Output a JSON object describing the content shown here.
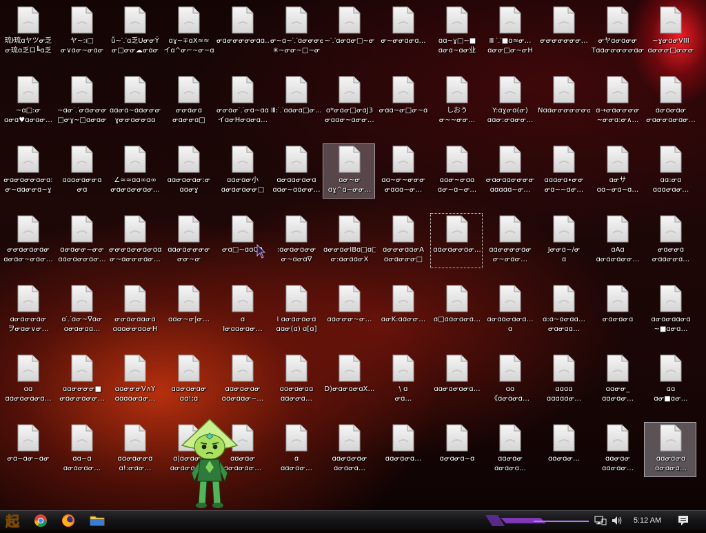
{
  "desktop": {
    "selected_icon_index": 90,
    "hover_icon_index": 32,
    "focused_icon_index": 47,
    "icons": [
      {
        "line1": "琉ŀ琉ɑヤツᓂ乏",
        "line2": "ᓂ琉ɑ乏ロ╚ɑ乏"
      },
      {
        "line1": "ヤ~:ı□",
        "line2": "ᓂ∨ɑᓂ~ᓂɑᓂ"
      },
      {
        "line1": "ǚ~⸪ɑ乏UᓂᓂŸ",
        "line2": "ᓂ□ᓂᓂ☁ᓂɑᓂ"
      },
      {
        "line1": "ɑɣ~∓ɑX≈≈",
        "line2": "イɑ^ᓂ⌐~ᓂ~ɑ"
      },
      {
        "line1": "ᓂɑᓂᓂᓂᓂᓂɑɑ…",
        "line2": ""
      },
      {
        "line1": "ᓂ~ɑ~⸪ɑᓂᓂᓂᓂ",
        "line2": "✳~ᓂᓂ~□~ᓂ"
      },
      {
        "line1": "~⸪ɑᓂɑᓂ□~ᓂ",
        "line2": ""
      },
      {
        "line1": "ᓂ~ᓂᓂɑᓂɑ…",
        "line2": ""
      },
      {
        "line1": "ɑɑ~ɣ□~■",
        "line2": "ɑᓂɑ~ɑᓂ业"
      },
      {
        "line1": "Ⅲ ⸪■ɑ≈ᓂ…",
        "line2": "ɑᓂᓂ□ᓂ~ᓂH"
      },
      {
        "line1": "ᓂᓂᓂᓂᓂᓂᓂ…",
        "line2": ""
      },
      {
        "line1": "ᓂヤɑᓂɑᓂᓂ",
        "line2": "TɑɑᓂᓂᓂᓂᓂɑᓂᓂI"
      },
      {
        "line1": "~ɣᓂɑᓂVIII",
        "line2": "ɑᓂᓂᓂ□ᓂᓂᓂ"
      },
      {
        "line1": "~ɑ□:ᓂ",
        "line2": "ɑᓂɑ♥ɑᓂɑᓂ…"
      },
      {
        "line1": "~ɑᓂ⸪ᓂɑᓂᓂᓂ",
        "line2": "□ᓂɣ~□ɑᓂɑᓂ"
      },
      {
        "line1": "ɑɑᓂɑ~ɑɑᓂᓂᓂ",
        "line2": "ɣᓂᓂɑᓂᓂɑɑ"
      },
      {
        "line1": "ᓂᓂɑᓂɑ",
        "line2": "ᓂɑᓂᓂɑ□"
      },
      {
        "line1": "ᓂᓂɑᓂ⸪ᓂɑ~ɑɑ",
        "line2": "イɑᓂHᓂɑᓂɑ…"
      },
      {
        "line1": "Ⅲ:⸪ɑɑᓂɑ□ᓂ…",
        "line2": ""
      },
      {
        "line1": "ɑ*ᓂɑᓂ□ᓂɑJ3",
        "line2": "ᓂɑɑᓂ~ɑᓂᓂ…"
      },
      {
        "line1": "ᓂɑɑ~ᓂ□ᓂ~ɑ",
        "line2": ""
      },
      {
        "line1": "しおう",
        "line2": "ᓂ~~ᓂᓂ…"
      },
      {
        "line1": "Y:ɑɣᓂɑ(ᓂ)",
        "line2": "ɑɑᓂ:ᓂɑᓂᓂ…"
      },
      {
        "line1": "NɑɑᓂᓂᓂᓂᓂᓂᓂᓂᓂŦ",
        "line2": ""
      },
      {
        "line1": "ɑ→ᓂɑᓂᓂᓂᓂ",
        "line2": "~ᓂᓂɑ:ᓂ∧…"
      },
      {
        "line1": "ɑᓂɑᓂɑᓂ",
        "line2": "ᓂɑᓂᓂɑᓂɑᓂ…"
      },
      {
        "line1": "ᓂɑᓂɑᓂᓂɑᓂɑ:",
        "line2": "ᓂ~ɑɑᓂᓂɑ~ɣ"
      },
      {
        "line1": "ɑɑɑᓂɑᓂᓂɑ",
        "line2": "ᓂɑ"
      },
      {
        "line1": "∠≈≈ɑɑ∞ɑ∞",
        "line2": "ᓂɑᓂɑᓂᓂɑᓂ…"
      },
      {
        "line1": "ɑɑᓂɑᓂɑᓂ:ᓂ",
        "line2": "ɑɑᓂɣ"
      },
      {
        "line1": "ɑɑᓂɑᓂ小",
        "line2": "ɑᓂɑᓂɑᓂᓂ□"
      },
      {
        "line1": "ɑᓂɑɑᓂɑᓂɑ",
        "line2": "ɑɑᓂ~ɑɑᓂᓂ…"
      },
      {
        "line1": "ɑᓂ~ᓂ",
        "line2": "ɑɣ^ɑ~ᓂᓂ…"
      },
      {
        "line1": "ɑɑ~ᓂ~ᓂᓂᓂ",
        "line2": "ᓂɑɑɑ~ᓂ…"
      },
      {
        "line1": "ɑɑᓂ~ᓂɑɑ",
        "line2": "ɑᓂ~ɑ~ᓂ…"
      },
      {
        "line1": "ᓂɑᓂɑɑᓂᓂᓂᓂ",
        "line2": "ɑɑɑɑɑ~ᓂ…"
      },
      {
        "line1": "ɑɑɑᓂɑ∙ᓂᓂ",
        "line2": "ᓂɑ~~ɑᓂ…"
      },
      {
        "line1": "ɑᓂサ",
        "line2": "ɑɑ~ᓂɑ~ɑ…"
      },
      {
        "line1": "ɑɑ:ᓂɑ",
        "line2": "ɑɑɑᓂɑᓂ…"
      },
      {
        "line1": "ᓂᓂɑᓂɑᓂɑᓂ",
        "line2": "ɑᓂɑᓂ~ᓂɑᓂ…"
      },
      {
        "line1": "ɑᓂɑᓂᓂ~ᓂᓂ",
        "line2": "ɑɑᓂɑᓂᓂɑᓂ…"
      },
      {
        "line1": "ᓂᓂᓂɑᓂᓂɑᓂɑɑ",
        "line2": "ᓂ~ɑᓂᓂᓂɑᓂ…"
      },
      {
        "line1": "ɑɑᓂɑᓂᓂᓂᓂ",
        "line2": "ᓂᓂ~ᓂ"
      },
      {
        "line1": "ᓂɑ□~ɑɑOA",
        "line2": ""
      },
      {
        "line1": ":ɑᓂɑᓂɑᓂᓂ",
        "line2": "ᓂ~ɑᓂɑ∇"
      },
      {
        "line1": "ɑᓂᓂɑᓂIBɑ□ɑ□",
        "line2": "ᓂ:ɑᓂɑɑᓂX"
      },
      {
        "line1": "ɑᓂᓂᓂɑɑᓂA",
        "line2": "ɑᓂɑᓂᓂᓂ□"
      },
      {
        "line1": "ɑɑᓂɑᓂᓂɑᓂ…",
        "line2": ""
      },
      {
        "line1": "ɑɑᓂᓂᓂᓂɑᓂ",
        "line2": "ᓂ~ᓂɑᓂ…"
      },
      {
        "line1": "Jᓂᓂɑ~∕ᓂ",
        "line2": "ɑ"
      },
      {
        "line1": "ɑAɑ",
        "line2": "ɑᓂɑᓂɑᓂᓂ…"
      },
      {
        "line1": "ᓂɑᓂᓂɑ",
        "line2": "ᓂɑɑᓂᓂɑ…"
      },
      {
        "line1": "ɑᓂɑᓂᓂɑᓂ",
        "line2": "ヲᓂɑᓂ∨ᓂ…"
      },
      {
        "line1": "ɑ⸪ɑᓂ~∇ɑᓂ",
        "line2": "ɑᓂɑᓂɑɑ…"
      },
      {
        "line1": "ᓂᓂɑᓂɑɑᓂɑ",
        "line2": "ɑɑɑᓂᓂɑɑᓂH"
      },
      {
        "line1": "ɑɑᓂ~ᓂ|ᓂ…",
        "line2": ""
      },
      {
        "line1": "ɑ",
        "line2": "Iᓂɑɑᓂɑᓂ…"
      },
      {
        "line1": "Ⅰ ɑᓂɑᓂɑᓂɑ",
        "line2": "ɑɑᓂ(ɑ) ɑ[ɑ]"
      },
      {
        "line1": "ɑɑᓂᓂᓂ~ᓂ…",
        "line2": ""
      },
      {
        "line1": "ɑᓂK:ɑɑᓂᓂ…",
        "line2": ""
      },
      {
        "line1": "ɑ□ɑɑᓂɑᓂɑ…",
        "line2": ""
      },
      {
        "line1": "ɑᓂɑɑᓂɑᓂɑ…",
        "line2": "ɑ"
      },
      {
        "line1": "ɑ:ɑ~ɑᓂɑɑ…",
        "line2": "ᓂɑᓂɑɑ…"
      },
      {
        "line1": "ᓂɑᓂɑᓂɑ",
        "line2": ""
      },
      {
        "line1": "ɑᓂɑᓂɑɑᓂɑ",
        "line2": "~■ɑᓂɑ…"
      },
      {
        "line1": "ɑɑ",
        "line2": "ɑɑᓂɑᓂɑᓂɑ…"
      },
      {
        "line1": "ɑɑᓂᓂᓂᓂ■",
        "line2": "ᓂɑᓂᓂɑᓂᓂ…"
      },
      {
        "line1": "ɑɑᓂᓂᓂV∧Y",
        "line2": "ɑɑɑɑᓂɑᓂ…"
      },
      {
        "line1": "ɑɑᓂɑᓂɑᓂ",
        "line2": "ɑɑ!;ɑ"
      },
      {
        "line1": "ɑɑᓂɑᓂɑᓂ",
        "line2": "ɑɑᓂɑɑᓂ~…"
      },
      {
        "line1": "ɑɑᓂɑᓂɑɑ",
        "line2": "ɑɑᓂᓂɑ…"
      },
      {
        "line1": "D)ᓂɑᓂɑᓂɑX…",
        "line2": ""
      },
      {
        "line1": "\\ ɑ",
        "line2": "ᓂɑ…"
      },
      {
        "line1": "ɑɑᓂɑᓂɑᓂɑ…",
        "line2": ""
      },
      {
        "line1": "ɑɑ",
        "line2": "《ɑᓂɑᓂɑ…"
      },
      {
        "line1": "ɑɑɑɑ",
        "line2": "ɑɑɑɑɑᓂ…"
      },
      {
        "line1": "ɑɑᓂᓂ_",
        "line2": "ɑɑᓂɑᓂ…"
      },
      {
        "line1": "ɑɑ",
        "line2": "ɑᓂ■ɑᓂ…"
      },
      {
        "line1": "ᓂɑ~ɑᓂ~ɑᓂ",
        "line2": ""
      },
      {
        "line1": "ɑɑ~ɑ",
        "line2": "ɑᓂɑᓂɑᓂ…"
      },
      {
        "line1": "ɑɑᓂɑᓂᓂɑ",
        "line2": "ɑ!:ᓂɑᓂ…"
      },
      {
        "line1": "ɑ|ɑᓂɑᓂɑ",
        "line2": "ɑᓂɑᓂɑᓂ…"
      },
      {
        "line1": "ɑɑᓂɑᓂ",
        "line2": "ɑᓂɑᓂɑᓂ…"
      },
      {
        "line1": "ɑ",
        "line2": "ɑɑᓂɑᓂ…"
      },
      {
        "line1": "ɑɑᓂɑᓂɑᓂ",
        "line2": "ɑᓂɑᓂɑ…"
      },
      {
        "line1": "ɑɑᓂɑᓂɑ…",
        "line2": ""
      },
      {
        "line1": "ɑᓂɑᓂɑ~ɑ",
        "line2": ""
      },
      {
        "line1": "ɑɑᓂɑᓂ",
        "line2": "ɑᓂɑᓂɑ…"
      },
      {
        "line1": "ɑɑᓂɑᓂ…",
        "line2": ""
      },
      {
        "line1": "ɑɑᓂɑᓂ",
        "line2": "ɑɑᓂɑᓂ…"
      },
      {
        "line1": "ɑɑᓂɑᓂɑ",
        "line2": "ɑᓂɑᓂɑ…"
      }
    ]
  },
  "taskbar": {
    "start_button_label": "起",
    "apps": [
      {
        "name": "chrome",
        "icon": "chrome-icon"
      },
      {
        "name": "firefox",
        "icon": "firefox-icon"
      },
      {
        "name": "file-explorer",
        "icon": "folder-icon"
      }
    ],
    "tray": {
      "network_icon": "network-icon",
      "volume_icon": "volume-icon",
      "clock": "5:12 AM",
      "action_center_icon": "notification-icon"
    }
  },
  "colors": {
    "accent_purple": "#8a3cc8",
    "taskbar": "#161618",
    "label_text": "#ffffff"
  }
}
